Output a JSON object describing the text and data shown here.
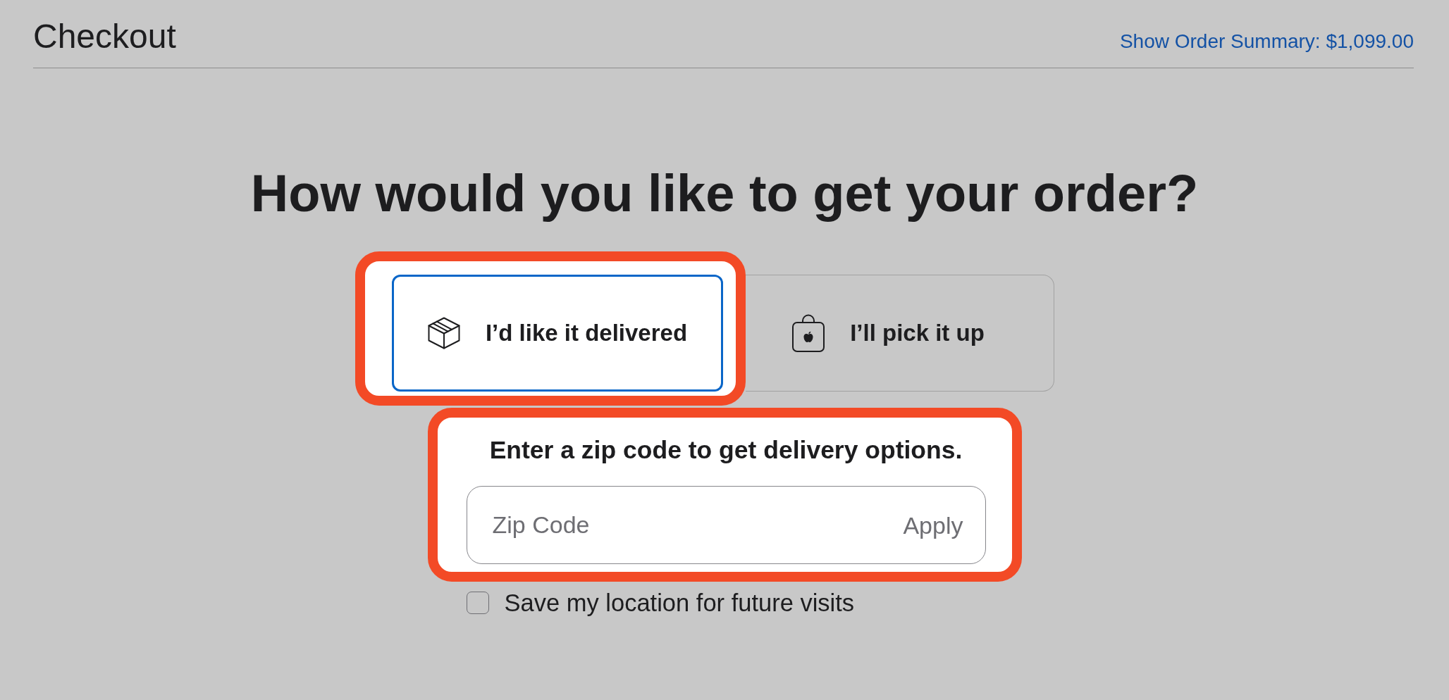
{
  "header": {
    "title": "Checkout",
    "summary_link": "Show Order Summary: $1,099.00"
  },
  "heading": "How would you like to get your order?",
  "options": [
    {
      "kind": "delivery",
      "label": "I’d like it delivered",
      "selected": true,
      "highlighted": true
    },
    {
      "kind": "pickup",
      "label": "I’ll pick it up",
      "selected": false,
      "highlighted": false
    }
  ],
  "zip_section": {
    "highlighted": true,
    "prompt": "Enter a zip code to get delivery options.",
    "field": {
      "placeholder": "Zip Code"
    },
    "apply_button": "Apply"
  },
  "save_location": {
    "label": "Save my location for future visits",
    "checked": false
  }
}
